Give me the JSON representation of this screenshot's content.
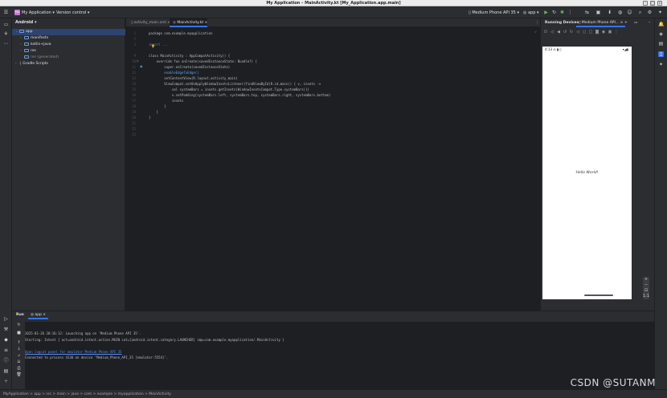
{
  "window": {
    "title": "My Application – MainActivity.kt [My_Application.app.main]",
    "controls": [
      "–",
      "□",
      "×"
    ]
  },
  "toolbar": {
    "project_badge": "MA",
    "project_name": "My Application",
    "vcs": "Version control",
    "device": "Medium Phone API 35",
    "run_config": "app"
  },
  "project_panel": {
    "title": "Android",
    "tree": [
      {
        "label": "app",
        "indent": 0,
        "selected": true
      },
      {
        "label": "manifests",
        "indent": 1
      },
      {
        "label": "kotlin+java",
        "indent": 1
      },
      {
        "label": "res",
        "indent": 1
      },
      {
        "label": "res (generated)",
        "indent": 1
      },
      {
        "label": "Gradle Scripts",
        "indent": 0
      }
    ]
  },
  "editor": {
    "tabs": [
      {
        "label": "activity_main.xml",
        "active": false
      },
      {
        "label": "MainActivity.kt",
        "active": true
      }
    ],
    "line_numbers": [
      "1",
      "2",
      "3",
      "",
      "",
      "",
      "",
      "",
      "9",
      "10",
      "11",
      "12",
      "13",
      "14",
      "15",
      "16",
      "17",
      "18",
      "19",
      "20",
      "21",
      "22",
      "23"
    ],
    "code": [
      "package com.example.myapplication",
      "",
      "import ...",
      "",
      "class MainActivity : AppCompatActivity() {",
      "    override fun onCreate(savedInstanceState: Bundle?) {",
      "        super.onCreate(savedInstanceState)",
      "        enableEdgeToEdge()",
      "        setContentView(R.layout.activity_main)",
      "        ViewCompat.setOnApplyWindowInsetsListener(findViewById(R.id.main)) { v, insets ->",
      "            val systemBars = insets.getInsets(WindowInsetsCompat.Type.systemBars())",
      "            v.setPadding(systemBars.left, systemBars.top, systemBars.right, systemBars.bottom)",
      "            insets",
      "        }",
      "    }",
      "}"
    ]
  },
  "devices_panel": {
    "title": "Running Devices",
    "device_tab": "Medium Phone API...",
    "phone": {
      "time": "4:13",
      "hello_text": "Hello World!"
    }
  },
  "run_panel": {
    "title": "Run",
    "tab": "app",
    "console": [
      "2025-01-26 20:16:12: Launching app on 'Medium Phone API 35'.",
      "Starting: Intent { act=android.intent.action.MAIN cat=[android.intent.category.LAUNCHER] cmp=com.example.myapplication/.MainActivity }",
      "",
      "Open logcat panel for emulator Medium Phone API 35",
      "Connected to process 4136 on device 'Medium_Phone_API_35 [emulator-5554]'."
    ]
  },
  "statusbar": {
    "breadcrumb": "MyApplication > app > src > main > java > com > example > myapplication > MainActivity"
  },
  "watermark": "CSDN @SUTANM"
}
